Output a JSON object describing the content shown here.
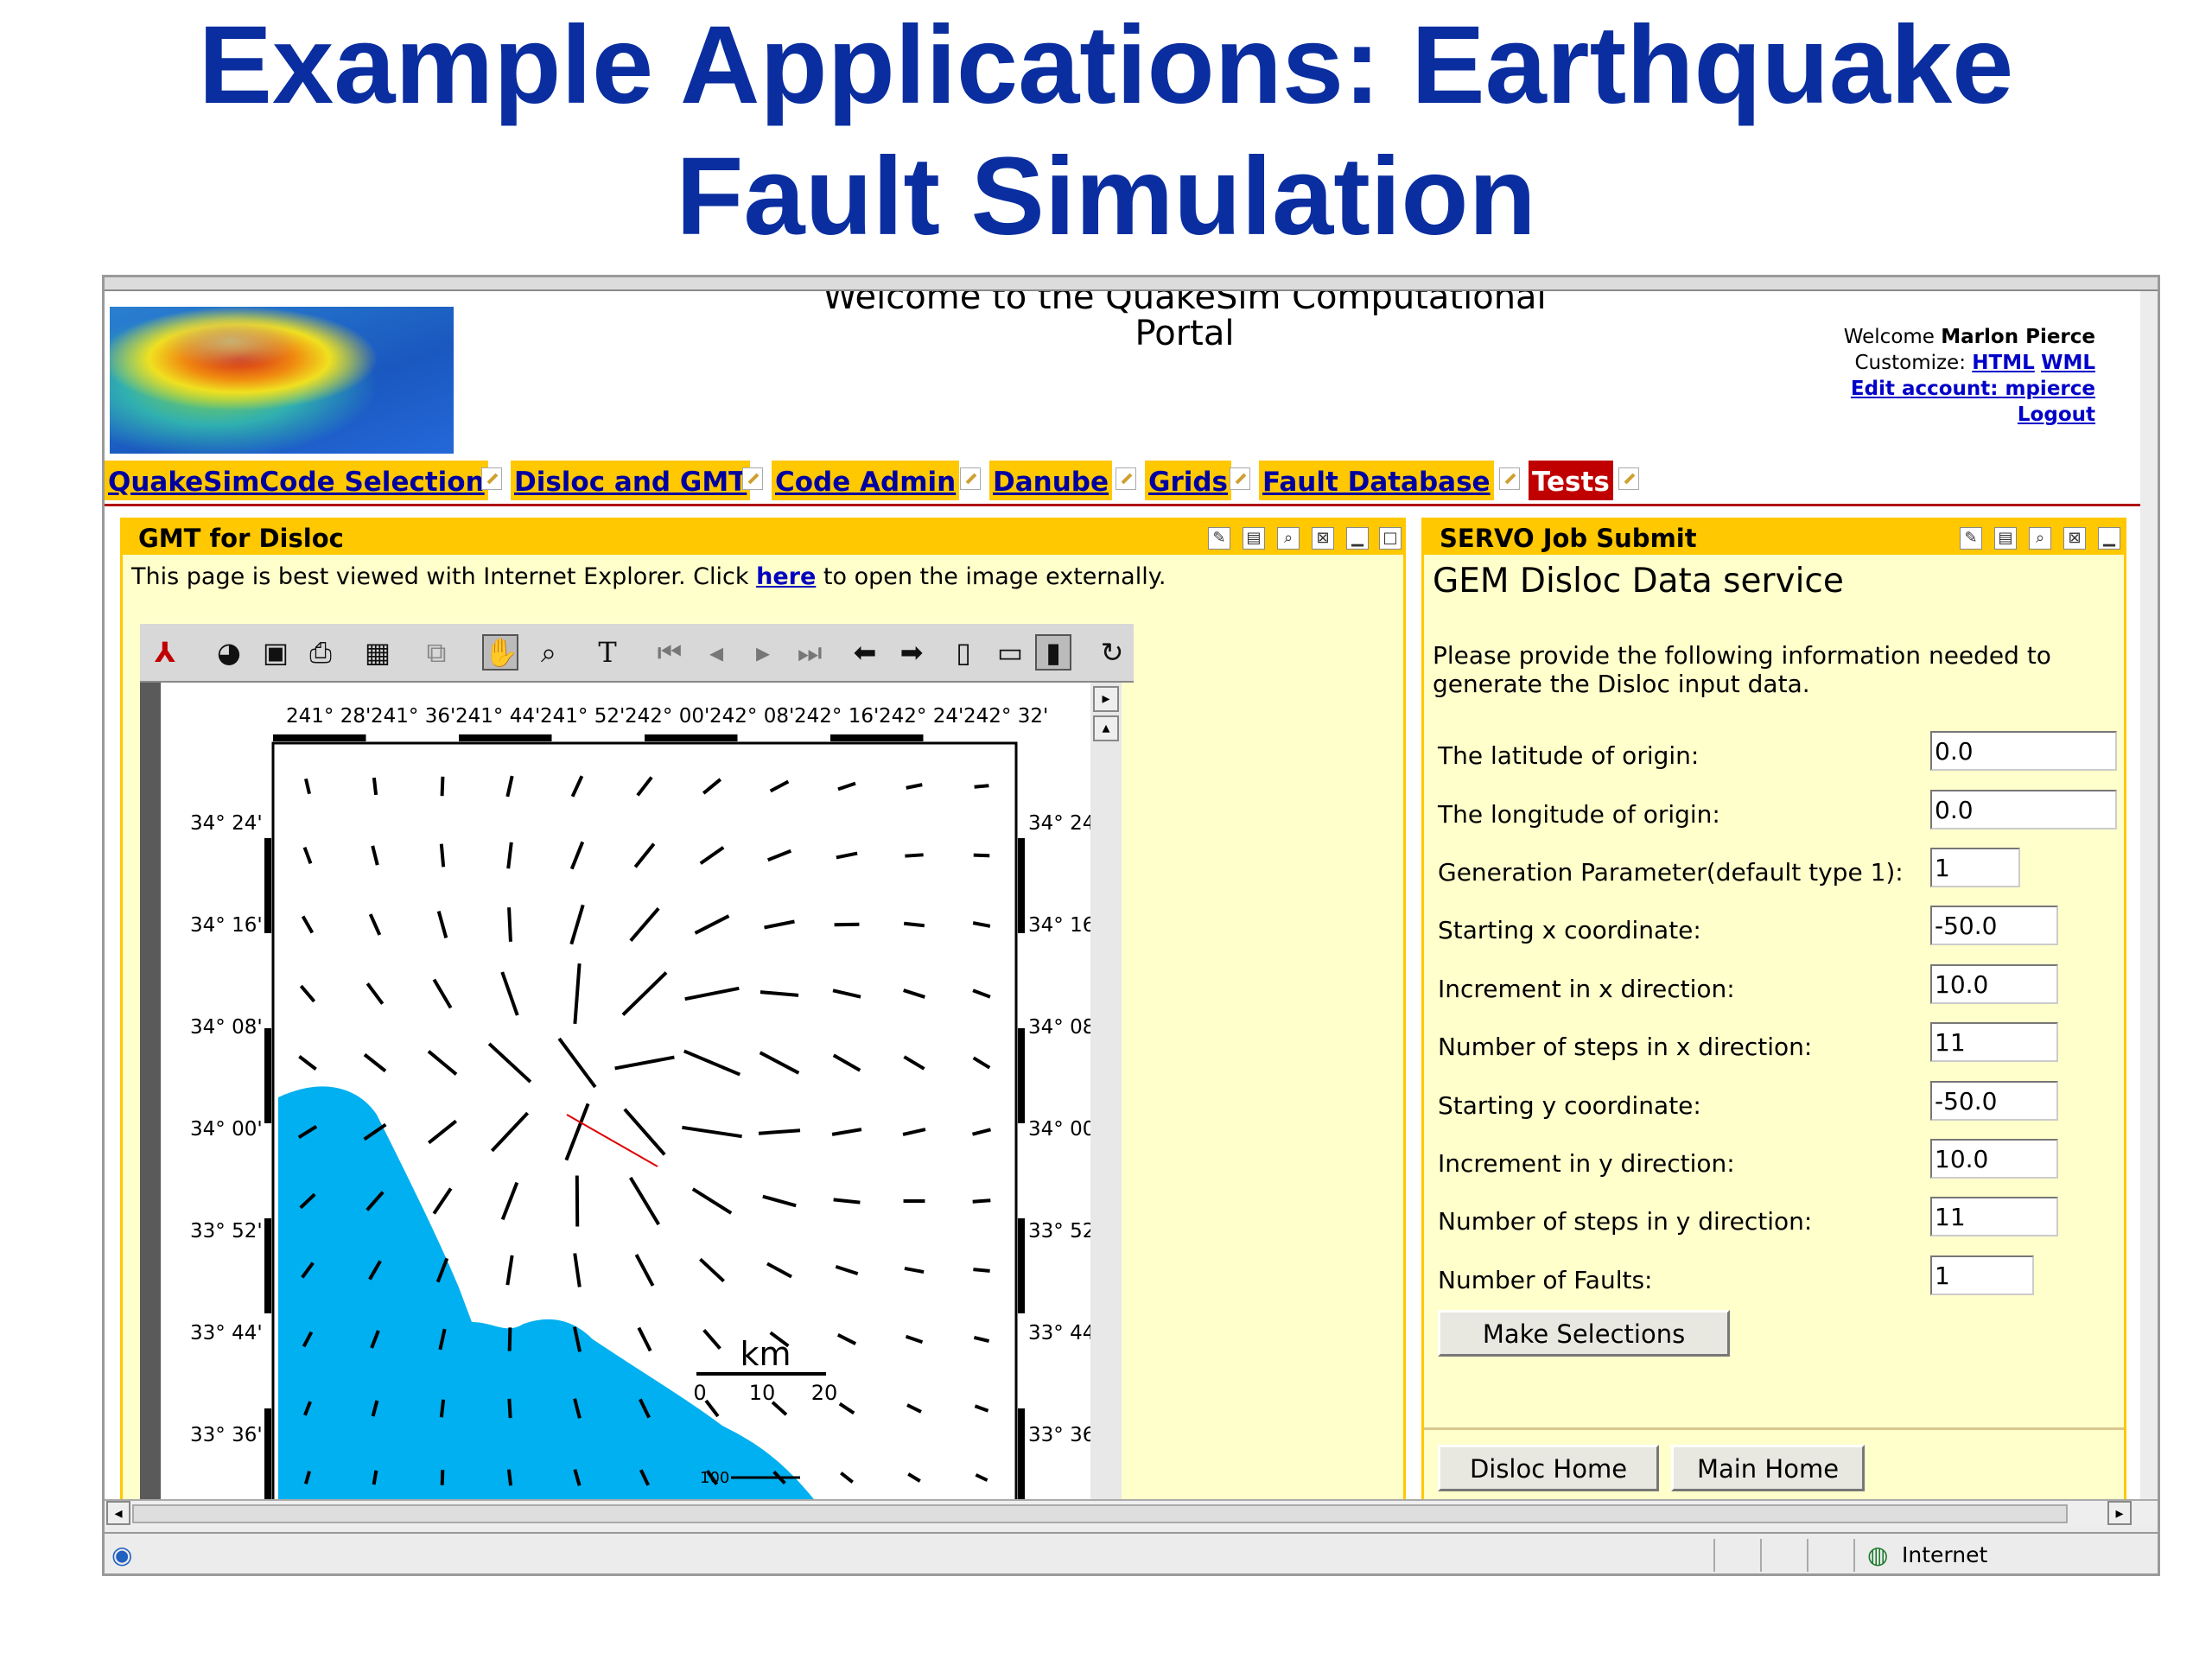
{
  "slide": {
    "title_line1": "Example Applications: Earthquake",
    "title_line2": "Fault Simulation"
  },
  "portal": {
    "title_line1": "Welcome to the QuakeSim Computational",
    "title_line2": "Portal",
    "welcome_prefix": "Welcome",
    "user_name": "Marlon Pierce",
    "customize_label": "Customize:",
    "customize_html": "HTML",
    "customize_wml": "WML",
    "edit_account": "Edit account: mpierce",
    "logout": "Logout"
  },
  "tabs": [
    {
      "label": "QuakeSimCode Selection"
    },
    {
      "label": "Disloc and GMT"
    },
    {
      "label": "Code Admin"
    },
    {
      "label": "Danube"
    },
    {
      "label": "Grids"
    },
    {
      "label": "Fault Database"
    },
    {
      "label": "Tests",
      "active": true
    }
  ],
  "left_panel": {
    "title": "GMT for Disloc",
    "note_before": "This page is best viewed with Internet Explorer. Click",
    "note_link": "here",
    "note_after": "to open the image externally."
  },
  "map": {
    "top_labels": [
      "241° 28'",
      "241° 36'",
      "241° 44'",
      "241° 52'",
      "242° 00'",
      "242° 08'",
      "242° 16'",
      "242° 24'",
      "242° 32'"
    ],
    "left_labels": [
      "34° 24'",
      "34° 16'",
      "34° 08'",
      "34° 00'",
      "33° 52'",
      "33° 44'",
      "33° 36'"
    ],
    "scale_unit": "km",
    "scale_ticks": [
      "0",
      "10",
      "20"
    ],
    "vector_legend": "100"
  },
  "right_panel": {
    "title": "SERVO Job Submit",
    "heading": "GEM Disloc Data service",
    "description": "Please provide the following information needed to generate the Disloc input data.",
    "fields": [
      {
        "label": "The latitude of origin:",
        "value": "0.0"
      },
      {
        "label": "The longitude of origin:",
        "value": "0.0"
      },
      {
        "label": "Generation Parameter(default type 1):",
        "value": "1"
      },
      {
        "label": "Starting x coordinate:",
        "value": "-50.0"
      },
      {
        "label": "Increment in x direction:",
        "value": "10.0"
      },
      {
        "label": "Number of steps in x direction:",
        "value": "11"
      },
      {
        "label": "Starting y coordinate:",
        "value": "-50.0"
      },
      {
        "label": "Increment in y direction:",
        "value": "10.0"
      },
      {
        "label": "Number of steps in y direction:",
        "value": "11"
      },
      {
        "label": "Number of Faults:",
        "value": "1"
      }
    ],
    "make_selections": "Make Selections",
    "disloc_home": "Disloc Home",
    "main_home": "Main Home"
  },
  "statusbar": {
    "zone": "Internet"
  },
  "colors": {
    "slide_title": "#0a2ea0",
    "tab_bar": "#ffc800",
    "tab_active": "#c00000",
    "panel_bg": "#ffffcc",
    "ocean": "#00b0f0",
    "fault": "#e00000"
  }
}
